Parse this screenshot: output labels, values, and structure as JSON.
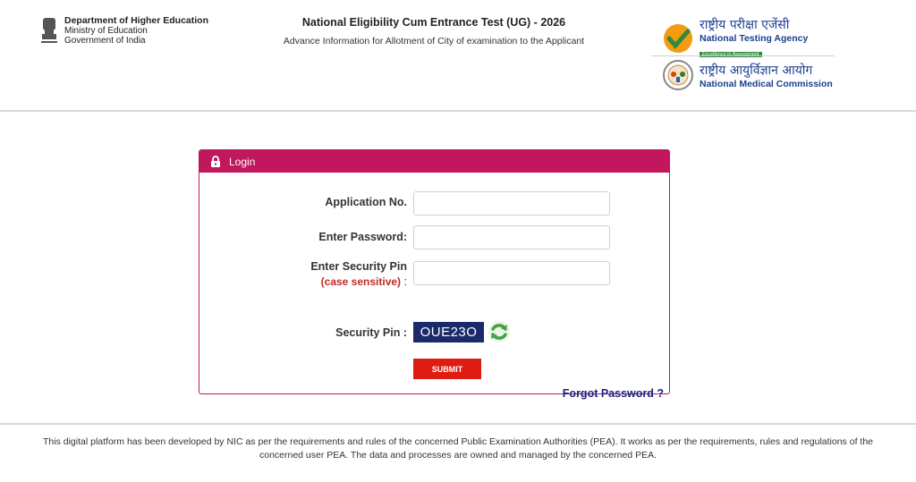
{
  "header": {
    "ministry": {
      "dept": "Department of Higher Education",
      "ministry": "Ministry of Education",
      "gov": "Government of India"
    },
    "title": "National Eligibility Cum Entrance Test (UG) - 2026",
    "subtitle": "Advance Information for Allotment of City of examination to the Applicant",
    "nta": {
      "hindi": "राष्ट्रीय परीक्षा एजेंसी",
      "english": "National Testing Agency",
      "tagline": "Excellence in Assessment"
    },
    "nmc": {
      "hindi": "राष्ट्रीय आयुर्विज्ञान आयोग",
      "english": "National Medical Commission"
    }
  },
  "login": {
    "heading": "Login",
    "application_label": "Application No.",
    "password_label": "Enter Password:",
    "security_label": "Enter Security Pin",
    "case_note": "(case sensitive)",
    "case_colon": " :",
    "pin_label": "Security Pin :",
    "captcha": "OUE23O",
    "submit_label": "SUBMIT",
    "forgot_label": "Forgot Password ?",
    "application_value": "",
    "password_value": "",
    "security_value": ""
  },
  "footer": {
    "text": "This digital platform has been developed by NIC as per the requirements and rules of the concerned Public Examination Authorities (PEA). It works as per the requirements, rules and regulations of the concerned user PEA. The data and processes are owned and managed by the concerned PEA."
  },
  "colors": {
    "panel_header": "#c0175d",
    "submit": "#e01b12",
    "captcha_bg": "#1b2a6b",
    "link": "#1a237e"
  },
  "icons": {
    "emblem": "india-emblem-icon",
    "nta_logo": "nta-check-logo",
    "nmc_logo": "nmc-logo",
    "lock": "lock-icon",
    "refresh": "refresh-icon"
  }
}
